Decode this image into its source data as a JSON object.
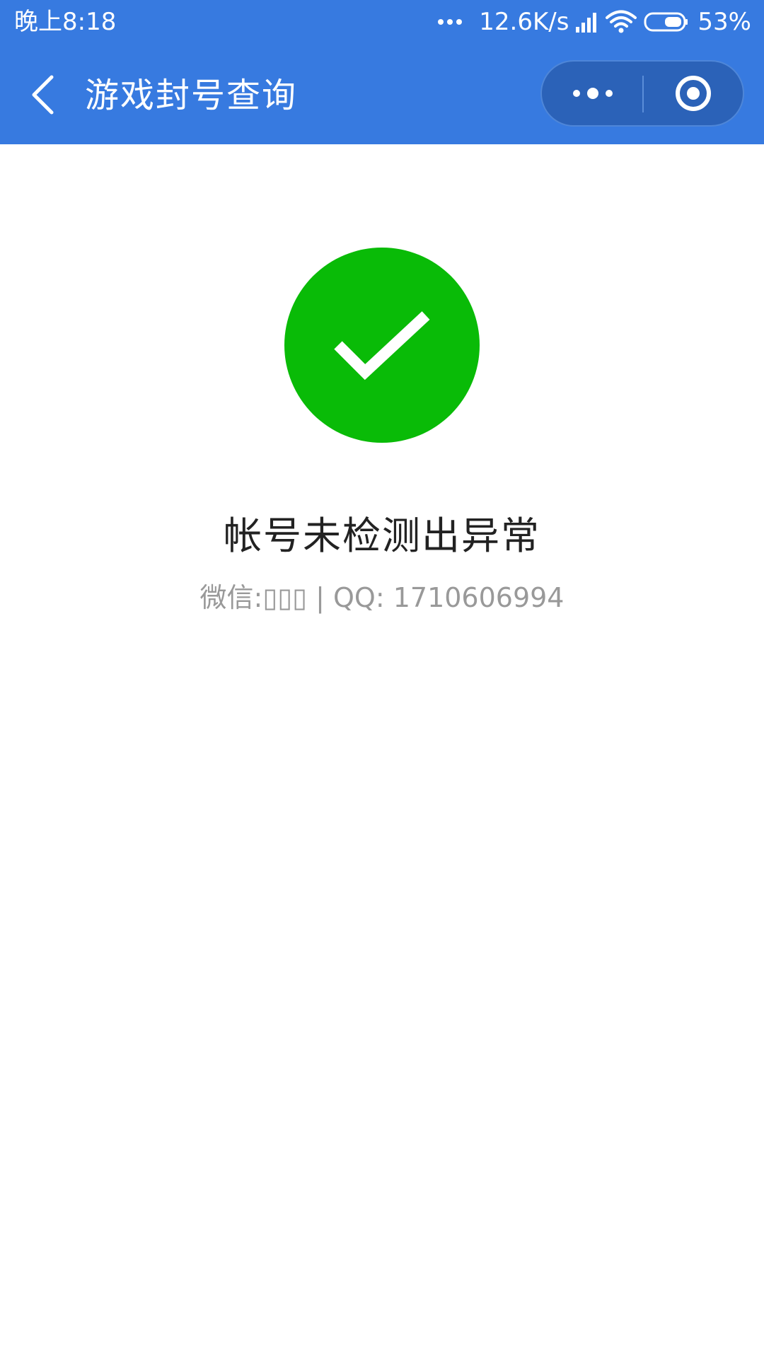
{
  "status_bar": {
    "time": "晚上8:18",
    "network_speed": "12.6K/s",
    "battery_percent": "53%",
    "icons": [
      "more-dots-icon",
      "signal-icon",
      "wifi-icon",
      "battery-icon"
    ]
  },
  "nav": {
    "title": "游戏封号查询",
    "back_icon": "chevron-left-icon",
    "capsule_icons": [
      "more-dots-icon",
      "close-target-icon"
    ]
  },
  "result": {
    "icon": "check-icon",
    "title": "帐号未检测出异常",
    "contact_text": "微信:▯▯▯ | QQ: 1710606994"
  },
  "colors": {
    "header": "#377AE0",
    "capsule": "#2B62B8",
    "success": "#09BB07",
    "title_text": "#222222",
    "muted_text": "#999999"
  }
}
